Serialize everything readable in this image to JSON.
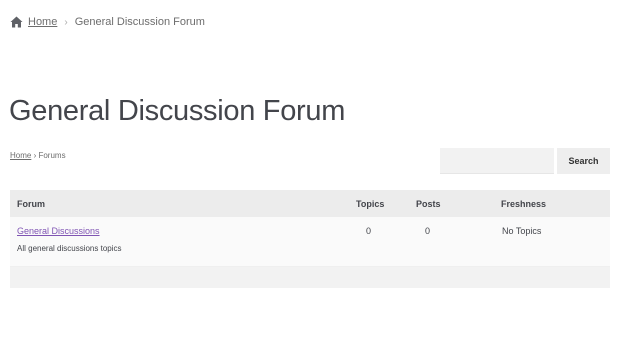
{
  "top_breadcrumb": {
    "home": "Home",
    "separator": "›",
    "current": "General Discussion Forum"
  },
  "page_title": "General Discussion Forum",
  "forum_breadcrumb": {
    "home": "Home",
    "separator": " › ",
    "current": "Forums"
  },
  "search": {
    "placeholder": "",
    "button_label": "Search"
  },
  "table": {
    "headers": {
      "forum": "Forum",
      "topics": "Topics",
      "posts": "Posts",
      "freshness": "Freshness"
    },
    "rows": [
      {
        "name": "General Discussions",
        "description": "All general discussions topics",
        "topics": "0",
        "posts": "0",
        "freshness": "No Topics"
      }
    ]
  },
  "colors": {
    "link_accent": "#7f54b3",
    "text": "#43454b"
  },
  "icons": {
    "home": "home-icon"
  }
}
